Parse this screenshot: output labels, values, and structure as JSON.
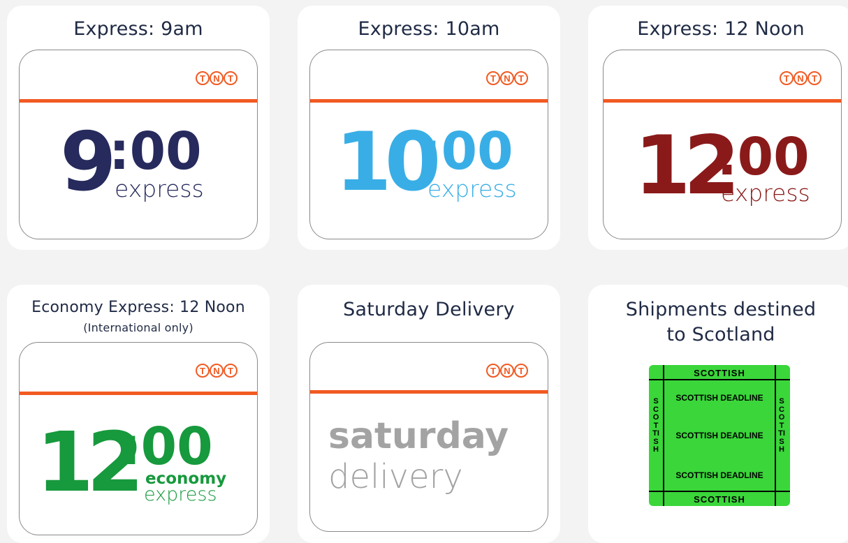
{
  "colors": {
    "orange": "#f15a22",
    "navy": "#262a5c",
    "sky": "#39aee6",
    "maroon": "#8a1a1a",
    "green": "#17993d",
    "grey": "#a3a3a3",
    "scot_green": "#3ad63a"
  },
  "tnt_logo": [
    "T",
    "N",
    "T"
  ],
  "cards": [
    {
      "title": "Express: 9am",
      "hour": "9",
      "minutes": ":00",
      "sub": "express"
    },
    {
      "title": "Express: 10am",
      "hour": "10",
      "minutes": ":00",
      "sub": "express"
    },
    {
      "title": "Express: 12 Noon",
      "hour": "12",
      "minutes": ":00",
      "sub": "express"
    },
    {
      "title": "Economy Express: 12 Noon",
      "subtitle": "(International only)",
      "hour": "12",
      "minutes": ":00",
      "sub1": "economy",
      "sub2": "express"
    },
    {
      "title": "Saturday Delivery",
      "line1": "saturday",
      "line2": "delivery"
    },
    {
      "title_line1": "Shipments destined",
      "title_line2": "to Scotland",
      "scottish": {
        "top": "SCOTTISH",
        "bottom": "SCOTTISH",
        "side": "SCOTTISH",
        "deadline": [
          "SCOTTISH DEADLINE",
          "SCOTTISH DEADLINE",
          "SCOTTISH DEADLINE"
        ]
      }
    }
  ]
}
